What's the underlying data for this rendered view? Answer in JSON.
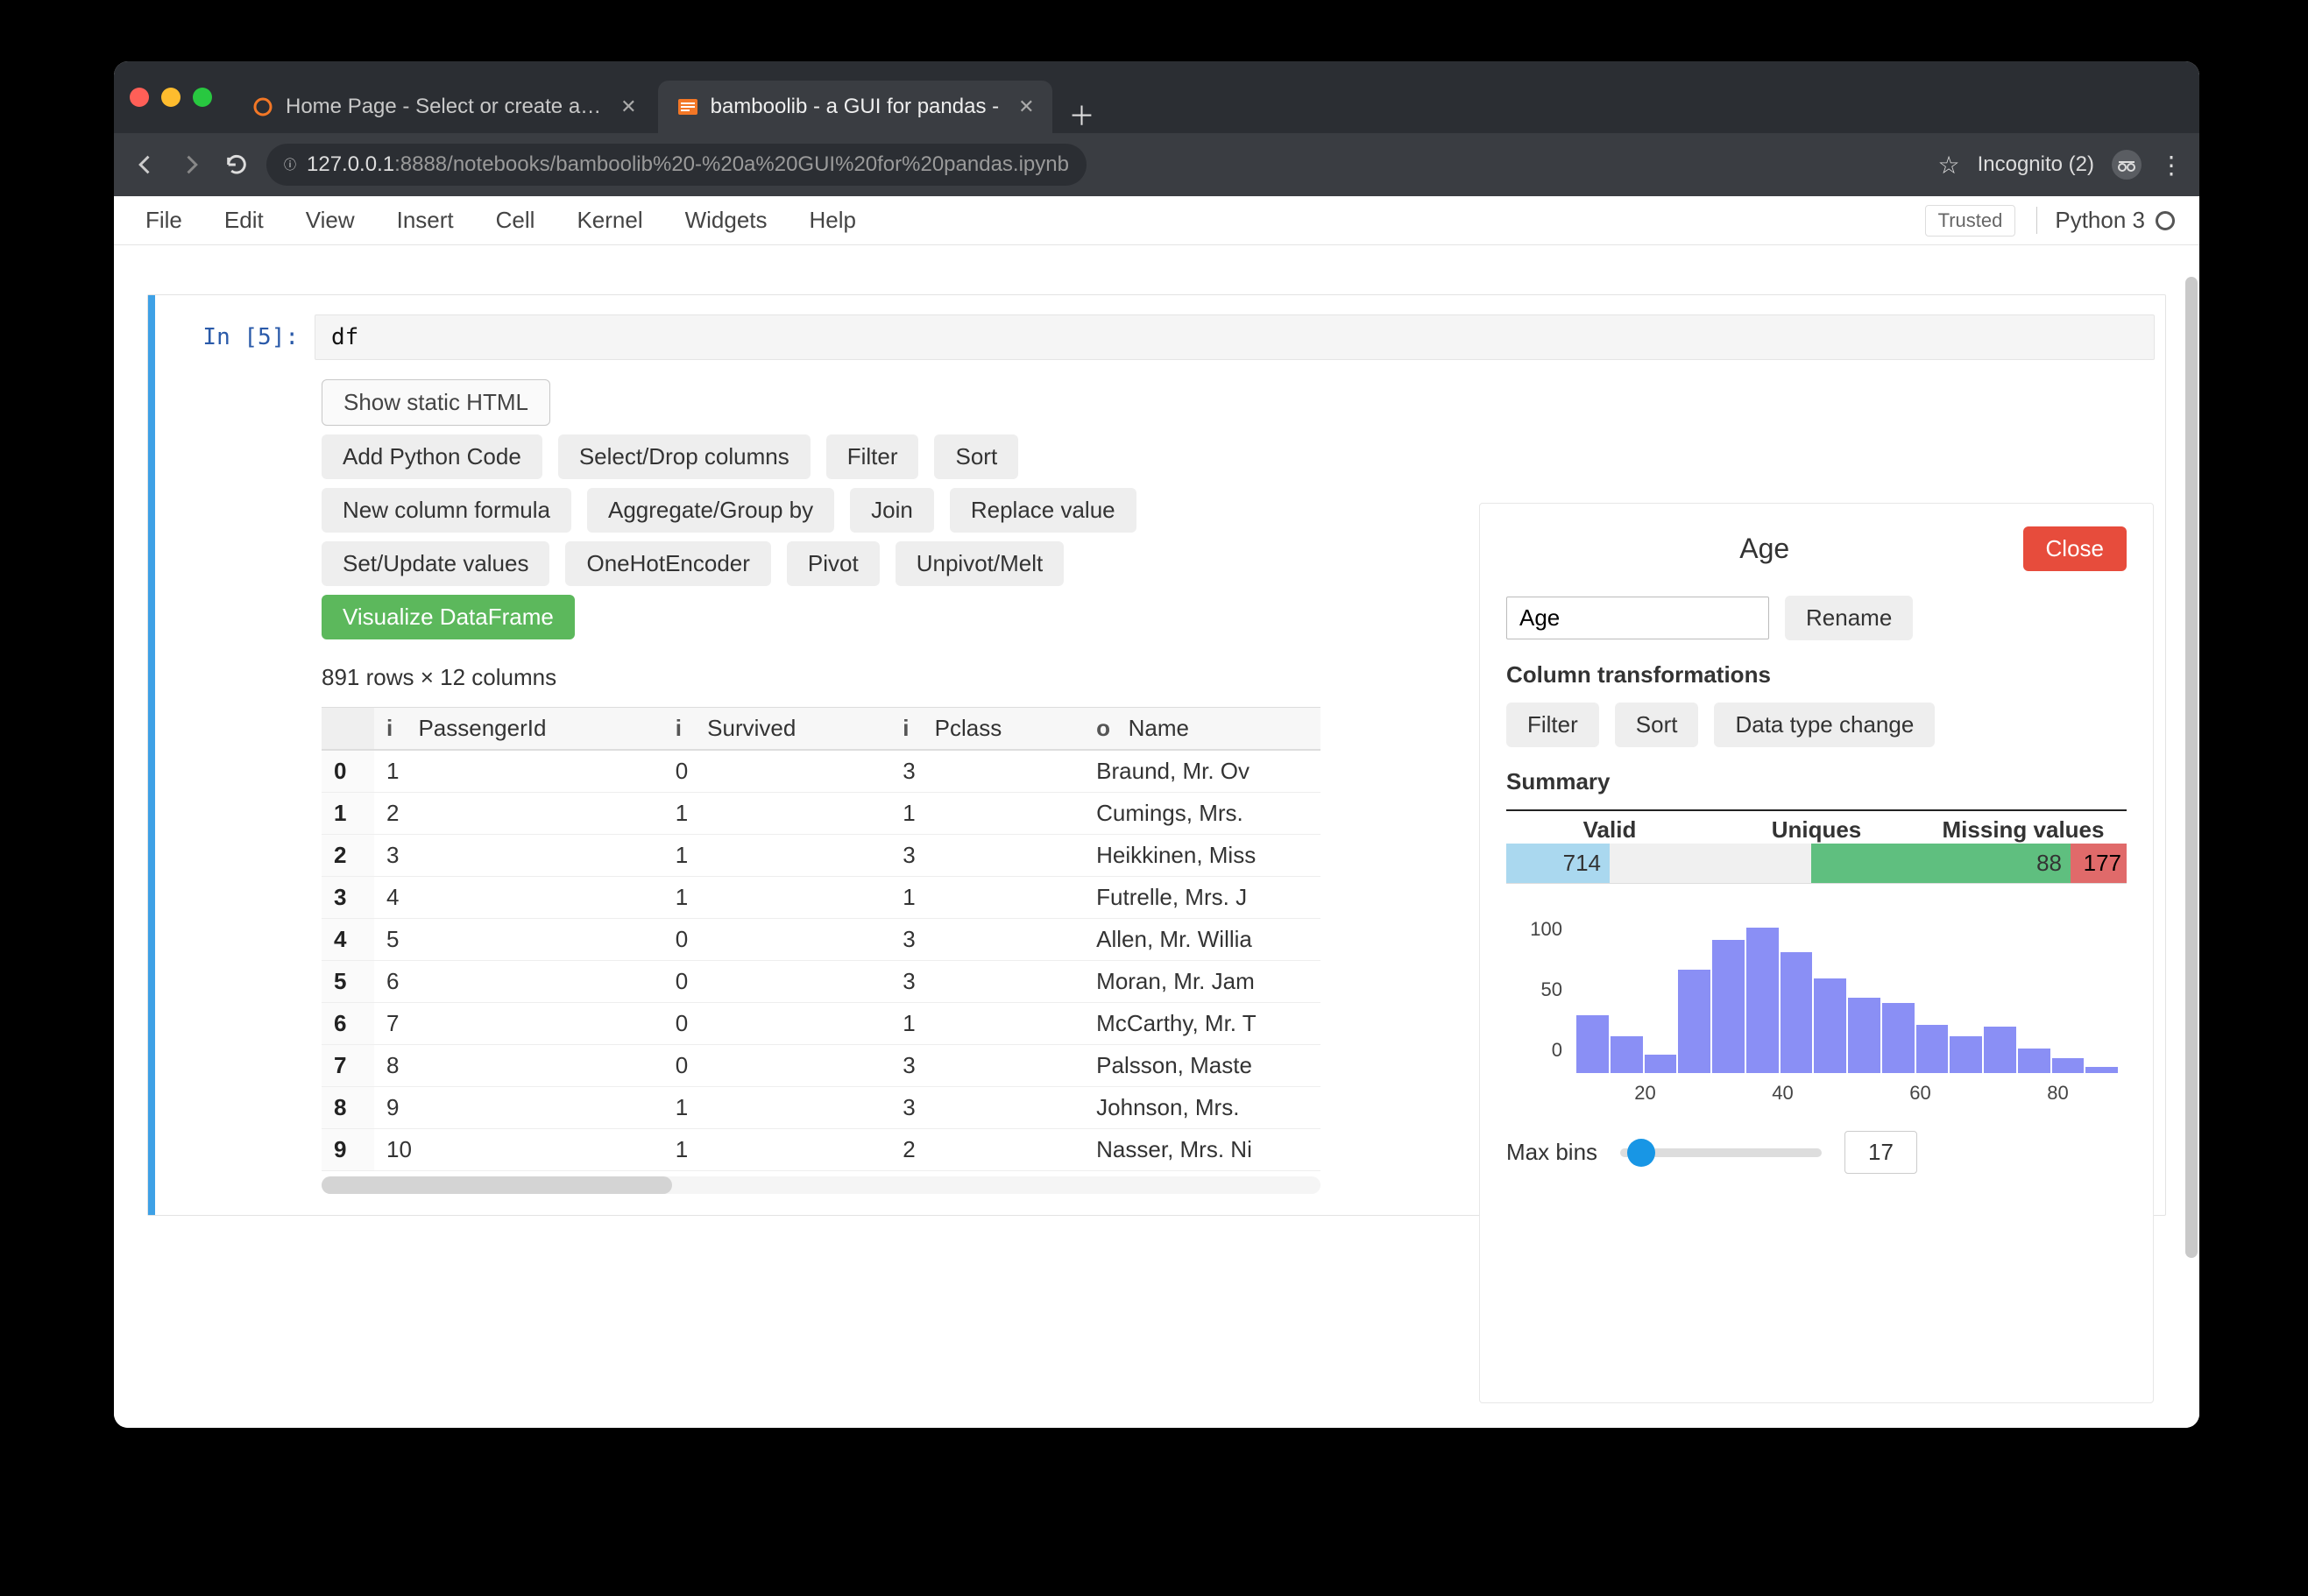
{
  "chrome": {
    "tabs": [
      {
        "title": "Home Page - Select or create a…",
        "active": false
      },
      {
        "title": "bamboolib - a GUI for pandas -",
        "active": true
      }
    ],
    "url_host": "127.0.0.1",
    "url_port": ":8888",
    "url_path": "/notebooks/bamboolib%20-%20a%20GUI%20for%20pandas.ipynb",
    "incognito_label": "Incognito (2)"
  },
  "jupyter": {
    "menus": [
      "File",
      "Edit",
      "View",
      "Insert",
      "Cell",
      "Kernel",
      "Widgets",
      "Help"
    ],
    "trusted": "Trusted",
    "kernel": "Python 3"
  },
  "cell": {
    "prompt": "In [5]:",
    "code": "df"
  },
  "toolbar": {
    "show_static": "Show static HTML",
    "row1": [
      "Add Python Code",
      "Select/Drop columns",
      "Filter",
      "Sort"
    ],
    "row2": [
      "New column formula",
      "Aggregate/Group by",
      "Join",
      "Replace value"
    ],
    "row3": [
      "Set/Update values",
      "OneHotEncoder",
      "Pivot",
      "Unpivot/Melt"
    ],
    "visualize": "Visualize DataFrame"
  },
  "df_summary": "891 rows × 12 columns",
  "columns": [
    {
      "prefix": "i",
      "name": "PassengerId"
    },
    {
      "prefix": "i",
      "name": "Survived"
    },
    {
      "prefix": "i",
      "name": "Pclass"
    },
    {
      "prefix": "o",
      "name": "Name"
    }
  ],
  "rows": [
    {
      "idx": "0",
      "PassengerId": "1",
      "Survived": "0",
      "Pclass": "3",
      "Name": "Braund, Mr. Ov"
    },
    {
      "idx": "1",
      "PassengerId": "2",
      "Survived": "1",
      "Pclass": "1",
      "Name": "Cumings, Mrs."
    },
    {
      "idx": "2",
      "PassengerId": "3",
      "Survived": "1",
      "Pclass": "3",
      "Name": "Heikkinen, Miss"
    },
    {
      "idx": "3",
      "PassengerId": "4",
      "Survived": "1",
      "Pclass": "1",
      "Name": "Futrelle, Mrs. J"
    },
    {
      "idx": "4",
      "PassengerId": "5",
      "Survived": "0",
      "Pclass": "3",
      "Name": "Allen, Mr. Willia"
    },
    {
      "idx": "5",
      "PassengerId": "6",
      "Survived": "0",
      "Pclass": "3",
      "Name": "Moran, Mr. Jam"
    },
    {
      "idx": "6",
      "PassengerId": "7",
      "Survived": "0",
      "Pclass": "1",
      "Name": "McCarthy, Mr. T"
    },
    {
      "idx": "7",
      "PassengerId": "8",
      "Survived": "0",
      "Pclass": "3",
      "Name": "Palsson, Maste"
    },
    {
      "idx": "8",
      "PassengerId": "9",
      "Survived": "1",
      "Pclass": "3",
      "Name": "Johnson, Mrs."
    },
    {
      "idx": "9",
      "PassengerId": "10",
      "Survived": "1",
      "Pclass": "2",
      "Name": "Nasser, Mrs. Ni"
    }
  ],
  "panel": {
    "title": "Age",
    "close": "Close",
    "name_value": "Age",
    "rename": "Rename",
    "transform_label": "Column transformations",
    "transforms": [
      "Filter",
      "Sort",
      "Data type change"
    ],
    "summary_label": "Summary",
    "summary_heads": [
      "Valid",
      "Uniques",
      "Missing values"
    ],
    "summary": {
      "valid": "714",
      "uniques": "88",
      "missing": "177"
    },
    "maxbins_label": "Max bins",
    "maxbins_value": "17"
  },
  "chart_data": {
    "type": "bar",
    "title": "",
    "xlabel": "",
    "ylabel": "",
    "y_ticks": [
      0,
      50,
      100
    ],
    "x_ticks": [
      20,
      40,
      60,
      80
    ],
    "categories": [
      2,
      7,
      12,
      17,
      22,
      27,
      32,
      37,
      42,
      47,
      52,
      57,
      62,
      67,
      72,
      77
    ],
    "values": [
      48,
      30,
      15,
      85,
      110,
      120,
      100,
      78,
      62,
      58,
      40,
      30,
      38,
      20,
      12,
      5
    ],
    "ylim": [
      0,
      130
    ]
  }
}
